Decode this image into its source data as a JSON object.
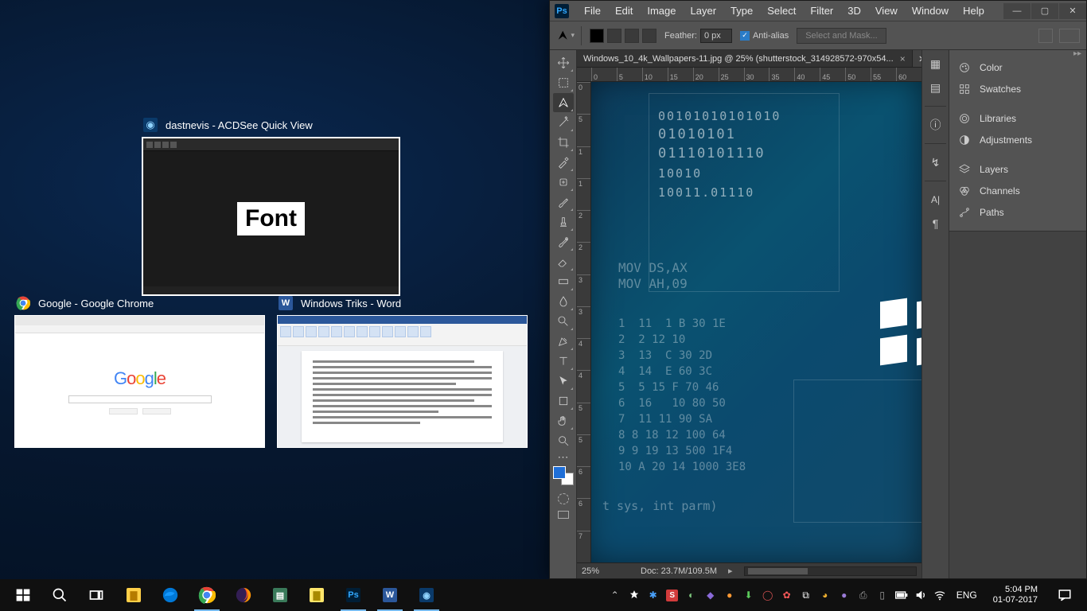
{
  "snap": {
    "acdsee": {
      "title": "dastnevis - ACDSee Quick View",
      "content_text": "Font"
    },
    "chrome": {
      "title": "Google - Google Chrome"
    },
    "word": {
      "title": "Windows Triks - Word"
    }
  },
  "photoshop": {
    "menus": [
      "File",
      "Edit",
      "Image",
      "Layer",
      "Type",
      "Select",
      "Filter",
      "3D",
      "View",
      "Window",
      "Help"
    ],
    "options": {
      "feather_label": "Feather:",
      "feather_value": "0 px",
      "antialias": "Anti-alias",
      "select_mask": "Select and Mask..."
    },
    "doc_tab": "Windows_10_4k_Wallpapers-11.jpg @ 25% (shutterstock_314928572-970x54...",
    "ruler_h": [
      "0",
      "5",
      "10",
      "15",
      "20",
      "25",
      "30",
      "35",
      "40",
      "45",
      "50",
      "55",
      "60"
    ],
    "ruler_v": [
      "0",
      "5",
      "1",
      "1",
      "2",
      "2",
      "3",
      "3",
      "4",
      "4",
      "5",
      "5",
      "6",
      "6",
      "7"
    ],
    "status": {
      "zoom": "25%",
      "doc": "Doc: 23.7M/109.5M"
    },
    "panels": [
      "Color",
      "Swatches",
      "Libraries",
      "Adjustments",
      "Layers",
      "Channels",
      "Paths"
    ],
    "image_text": {
      "bin1": "00101010101010",
      "bin2": "01010101",
      "bin3": "01110101110",
      "bin4": "10010",
      "bin5": "10011.01110",
      "asm1": "MOV DS,AX",
      "asm2": "MOV AH,09",
      "list": "1  11  1 B 30 1E\n2  2 12 10\n3  13  C 30 2D\n4  14  E 60 3C\n5  5 15 F 70 46\n6  16   10 80 50\n7  11 11 90 SA\n8 8 18 12 100 64\n9 9 19 13 500 1F4\n10 A 20 14 1000 3E8",
      "foot": "t sys, int parm)"
    }
  },
  "taskbar": {
    "lang": "ENG",
    "time": "5:04 PM",
    "date": "01-07-2017"
  }
}
